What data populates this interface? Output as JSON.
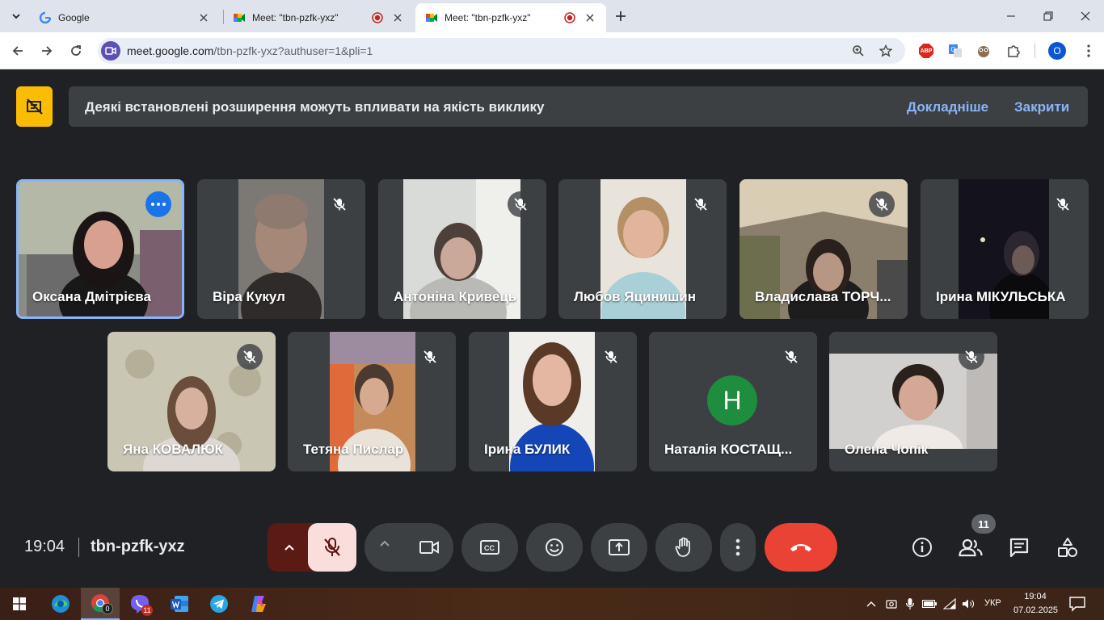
{
  "browser": {
    "tabs": [
      {
        "title": "Google",
        "active": false,
        "recording": false
      },
      {
        "title": "Meet: \"tbn-pzfk-yxz\"",
        "active": false,
        "recording": true
      },
      {
        "title": "Meet: \"tbn-pzfk-yxz\"",
        "active": true,
        "recording": true
      }
    ],
    "url_host": "meet.google.com",
    "url_path": "/tbn-pzfk-yxz?authuser=1&pli=1",
    "profile_initial": "O",
    "extensions": [
      "adblock-icon",
      "translate-icon",
      "owl-extension-icon",
      "puzzle-icon"
    ]
  },
  "notice": {
    "text": "Деякі встановлені розширення можуть впливати на якість виклику",
    "learn_more": "Докладніше",
    "close": "Закрити"
  },
  "participants": [
    {
      "name": "Оксана Дмітрієва",
      "selected": true,
      "muted": false
    },
    {
      "name": "Віра Кукул",
      "muted": true
    },
    {
      "name": "Антоніна Кривець",
      "muted": true
    },
    {
      "name": "Любов Яцинишин",
      "muted": true
    },
    {
      "name": "Владислава ТОРЧ...",
      "muted": true
    },
    {
      "name": "Ірина МІКУЛЬСЬКА",
      "muted": true
    },
    {
      "name": "Яна КОВАЛЮК",
      "muted": true
    },
    {
      "name": "Тетяна Пислар",
      "muted": true
    },
    {
      "name": "Ірина БУЛИК",
      "muted": true
    },
    {
      "name": "Наталія КОСТАЩ...",
      "muted": true,
      "avatar_initial": "H",
      "avatar_color": "#1e8e3e"
    },
    {
      "name": "Олена Чопік",
      "muted": true
    }
  ],
  "controls": {
    "time": "19:04",
    "meeting_code": "tbn-pzfk-yxz",
    "participant_count": "11",
    "end_call_color": "#ea4335"
  },
  "taskbar": {
    "apps": [
      "edge-icon",
      "chrome-icon",
      "viber-icon",
      "word-icon",
      "telegram-icon",
      "copilot-icon"
    ],
    "chrome_badge": "0",
    "viber_badge": "11",
    "language": "УКР",
    "time": "19:04",
    "date": "07.02.2025"
  }
}
